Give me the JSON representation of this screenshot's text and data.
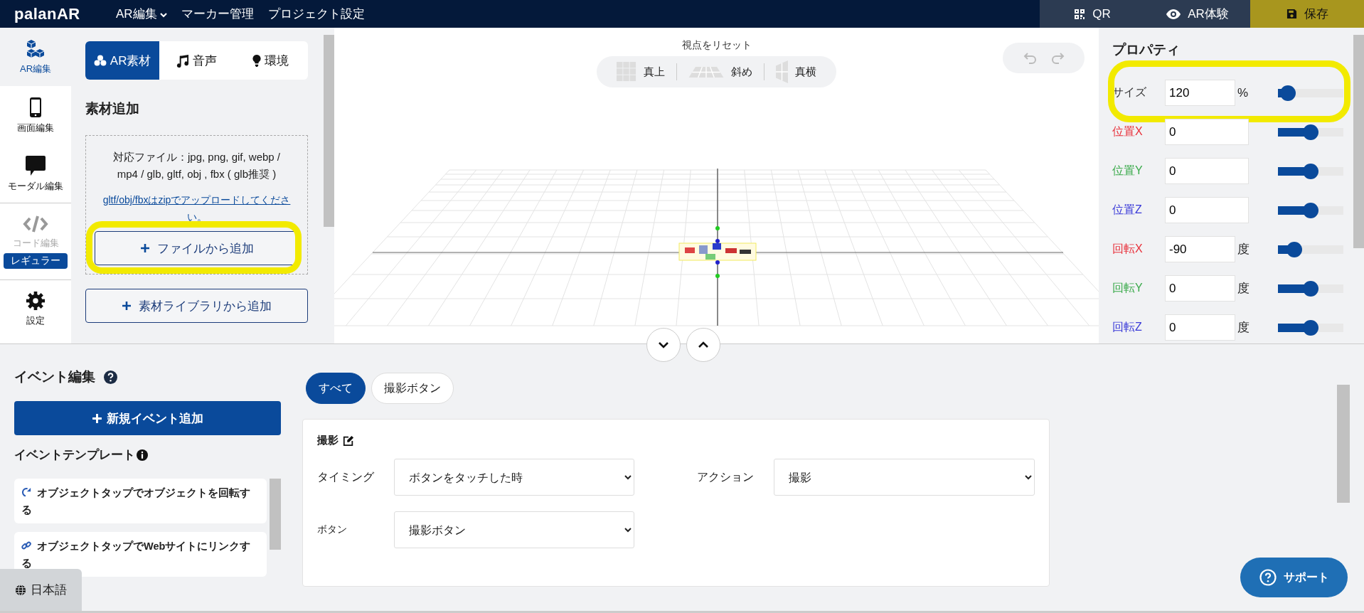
{
  "header": {
    "logo": "palanAR",
    "nav": [
      {
        "label": "AR編集",
        "dropdown": true
      },
      {
        "label": "マーカー管理",
        "dropdown": false
      },
      {
        "label": "プロジェクト設定",
        "dropdown": false
      }
    ],
    "actions": [
      {
        "label": "QR",
        "kind": "qr"
      },
      {
        "label": "AR体験",
        "kind": "preview"
      },
      {
        "label": "保存",
        "kind": "save"
      }
    ]
  },
  "sidebar": {
    "items": [
      {
        "label": "AR編集",
        "selected": true,
        "disabled": false
      },
      {
        "label": "画面編集",
        "selected": false,
        "disabled": false
      },
      {
        "label": "モーダル編集",
        "selected": false,
        "disabled": false
      },
      {
        "label": "コード編集",
        "selected": false,
        "disabled": true,
        "badge": "レギュラー"
      },
      {
        "label": "設定",
        "selected": false,
        "disabled": false
      }
    ]
  },
  "asset_panel": {
    "tabs": [
      {
        "label": "AR素材",
        "selected": true
      },
      {
        "label": "音声",
        "selected": false
      },
      {
        "label": "環境",
        "selected": false
      }
    ],
    "heading": "素材追加",
    "formats": "対応ファイル：jpg, png, gif, webp / mp4 / glb, gltf, obj , fbx ( glb推奨 )",
    "zip_link": "gltf/obj/fbxはzipでアップロードしてください。",
    "file_button": {
      "label": "ファイルから追加",
      "highlighted": true
    },
    "library_button": {
      "label": "素材ライブラリから追加",
      "highlighted": false
    }
  },
  "viewport": {
    "reset_label": "視点をリセット",
    "views": [
      {
        "label": "真上",
        "kind": "top"
      },
      {
        "label": "斜め",
        "kind": "oblique"
      },
      {
        "label": "真横",
        "kind": "side"
      }
    ]
  },
  "properties": {
    "title": "プロパティ",
    "rows": [
      {
        "label": "サイズ",
        "value": "120",
        "unit": "%",
        "level": 0.15,
        "color": "#333333",
        "highlighted": true
      },
      {
        "label": "位置X",
        "value": "0",
        "level": 0.5,
        "color": "#e8303a",
        "highlighted": false
      },
      {
        "label": "位置Y",
        "value": "0",
        "level": 0.5,
        "color": "#3aaa4a",
        "highlighted": false
      },
      {
        "label": "位置Z",
        "value": "0",
        "level": 0.5,
        "color": "#3a3ad8",
        "highlighted": false
      },
      {
        "label": "回転X",
        "value": "-90",
        "unit": "度",
        "level": 0.25,
        "color": "#e8303a",
        "highlighted": false
      },
      {
        "label": "回転Y",
        "value": "0",
        "unit": "度",
        "level": 0.5,
        "color": "#3aaa4a",
        "highlighted": false
      },
      {
        "label": "回転Z",
        "value": "0",
        "unit": "度",
        "level": 0.5,
        "color": "#3a3ad8",
        "highlighted": false
      }
    ]
  },
  "events": {
    "title": "イベント編集",
    "add_button": "新規イベント追加",
    "templates_title": "イベントテンプレート",
    "templates": [
      {
        "label": "オブジェクトタップでオブジェクトを回転する"
      },
      {
        "label": "オブジェクトタップでWebサイトにリンクする"
      }
    ],
    "filters": [
      {
        "label": "すべて",
        "selected": true
      },
      {
        "label": "撮影ボタン",
        "selected": false
      }
    ],
    "card": {
      "title": "撮影",
      "fields": [
        {
          "label": "タイミング",
          "value": "ボタンをタッチした時"
        },
        {
          "label": "ボタン",
          "value": "撮影ボタン"
        }
      ],
      "action": {
        "label": "アクション",
        "value": "撮影"
      }
    }
  },
  "language": "日本語",
  "support": "サポート"
}
